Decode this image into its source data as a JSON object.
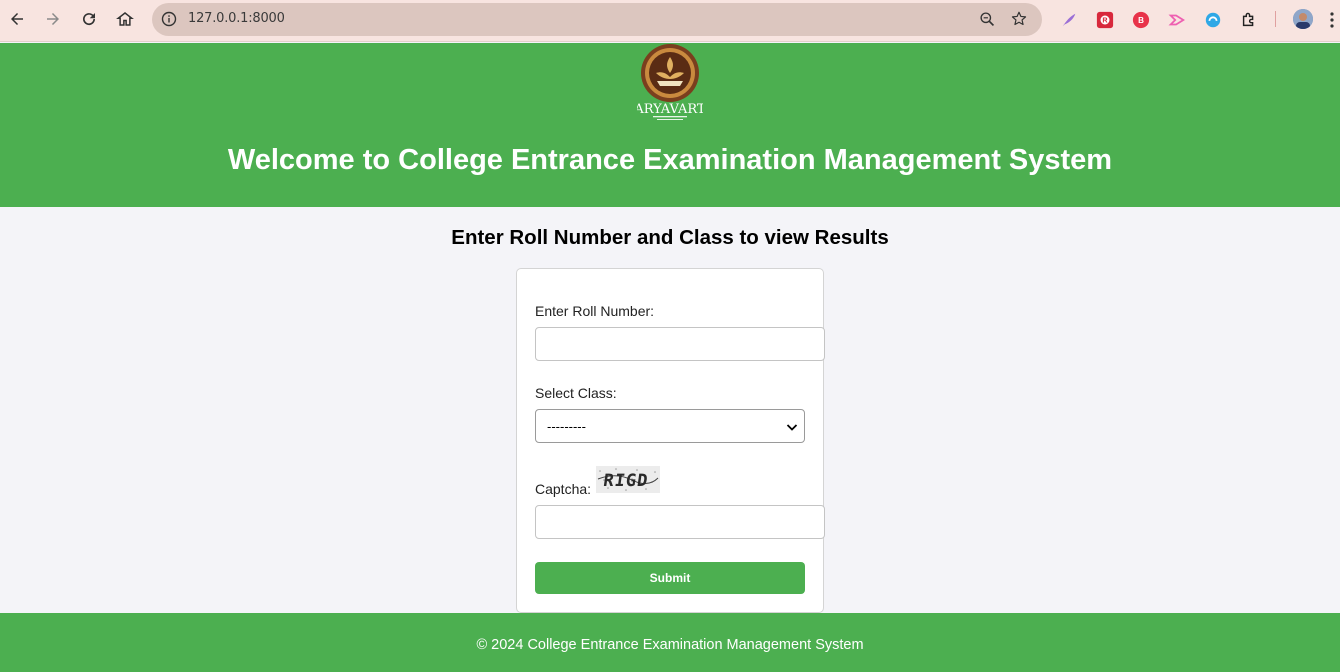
{
  "browser": {
    "url": "127.0.0.1:8000",
    "extensions": [
      "quill-icon",
      "r-extension-icon",
      "b-extension-icon",
      "arrow-extension-icon",
      "swirl-extension-icon",
      "puzzle-icon"
    ]
  },
  "header": {
    "logo_text": "ARYAVART",
    "title": "Welcome to College Entrance Examination Management System"
  },
  "main": {
    "heading": "Enter Roll Number and Class to view Results",
    "form": {
      "roll_label": "Enter Roll Number:",
      "roll_value": "",
      "class_label": "Select Class:",
      "class_selected": "---------",
      "captcha_label": "Captcha:",
      "captcha_text": "RIGD",
      "captcha_value": "",
      "submit_label": "Submit"
    }
  },
  "footer": {
    "text": "© 2024 College Entrance Examination Management System"
  },
  "colors": {
    "brand_green": "#4caf50",
    "page_bg": "#f4f4f8",
    "chrome_bg": "#f8e4e0"
  }
}
